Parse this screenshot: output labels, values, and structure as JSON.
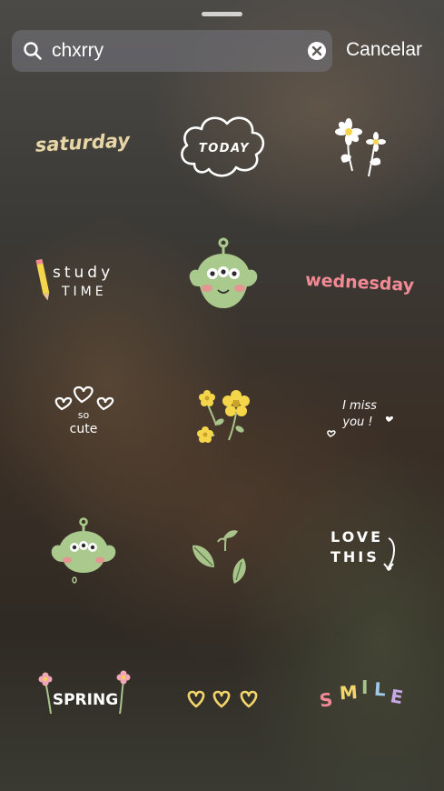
{
  "search": {
    "value": "chxrry",
    "cancel_label": "Cancelar"
  },
  "stickers": [
    {
      "icon": "sticker-saturday",
      "text": "saturday"
    },
    {
      "icon": "sticker-today-cloud",
      "text": "TODAY"
    },
    {
      "icon": "sticker-daisy-flowers",
      "text": ""
    },
    {
      "icon": "sticker-study-time",
      "text": "study TIME"
    },
    {
      "icon": "sticker-green-alien",
      "text": ""
    },
    {
      "icon": "sticker-wednesday",
      "text": "wednesday"
    },
    {
      "icon": "sticker-so-cute-hearts",
      "text": "so cute"
    },
    {
      "icon": "sticker-yellow-flowers",
      "text": ""
    },
    {
      "icon": "sticker-i-miss-you",
      "text": "I miss you !"
    },
    {
      "icon": "sticker-green-alien-small",
      "text": ""
    },
    {
      "icon": "sticker-green-leaves",
      "text": ""
    },
    {
      "icon": "sticker-love-this",
      "text": "LOVE THIS"
    },
    {
      "icon": "sticker-spring",
      "text": "SPRING"
    },
    {
      "icon": "sticker-yellow-hearts",
      "text": ""
    },
    {
      "icon": "sticker-smile",
      "text": "SMILE"
    }
  ],
  "colors": {
    "saturday": "#e8d6a6",
    "wednesday": "#f28a95",
    "alien_green": "#a9c98d",
    "flower_yellow": "#f5d64a",
    "leaf_green": "#a8c48a",
    "heart_yellow": "#f3d56b"
  }
}
